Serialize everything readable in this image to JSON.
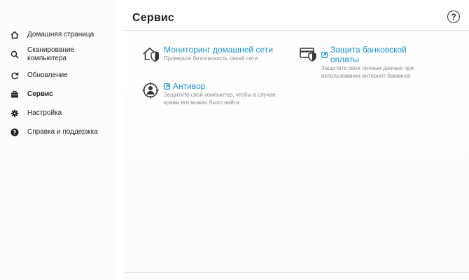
{
  "sidebar": {
    "items": [
      {
        "label": "Домашняя страница",
        "icon": "home-icon",
        "active": false
      },
      {
        "label": "Сканирование компьютера",
        "icon": "search-icon",
        "active": false
      },
      {
        "label": "Обновление",
        "icon": "refresh-icon",
        "active": false
      },
      {
        "label": "Сервис",
        "icon": "briefcase-icon",
        "active": true
      },
      {
        "label": "Настройка",
        "icon": "gear-icon",
        "active": false
      },
      {
        "label": "Справка и поддержка",
        "icon": "help-circle-icon",
        "active": false
      }
    ]
  },
  "main": {
    "title": "Сервис",
    "help_glyph": "?",
    "tiles": [
      {
        "title": "Мониторинг домашней сети",
        "description": "Проверьте безопасность своей сети",
        "icon": "home-network-shield-icon",
        "external": false
      },
      {
        "title": "Защита банковской оплаты",
        "description": "Защитите свои личные данные при использовании интернет-банкинга",
        "icon": "bank-card-shield-icon",
        "external": true
      },
      {
        "title": "Антивор",
        "description": "Защитите свой компьютер, чтобы в случае кражи его можно было найти",
        "icon": "anti-theft-icon",
        "external": true
      }
    ]
  },
  "colors": {
    "accent": "#1f8fcf",
    "brand": "#2fa58f",
    "muted_text": "#8a8a8a"
  }
}
